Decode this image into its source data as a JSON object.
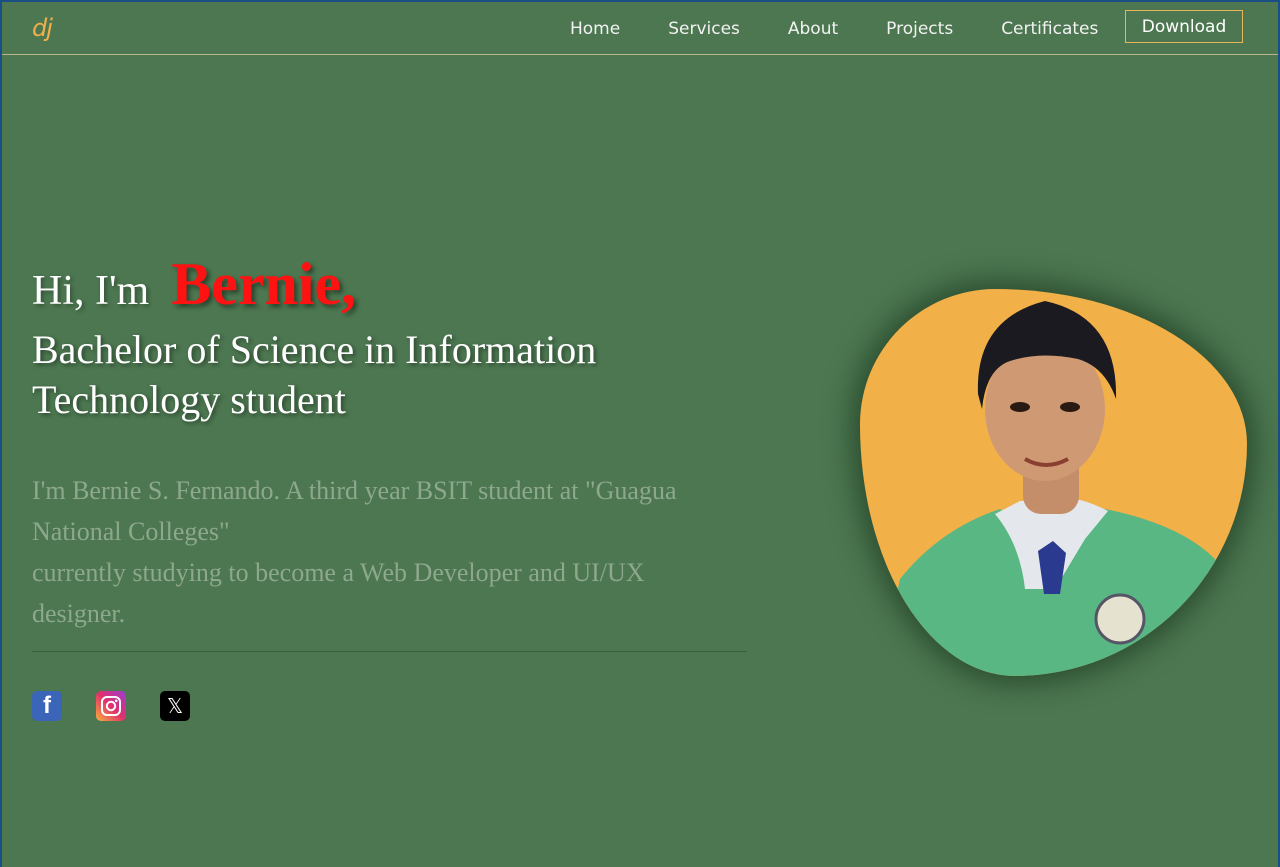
{
  "brand": {
    "logo": "dj"
  },
  "nav": {
    "items": [
      "Home",
      "Services",
      "About",
      "Projects",
      "Certificates"
    ],
    "download_label": "Download"
  },
  "hero": {
    "greeting": "Hi, I'm",
    "name": "Bernie,",
    "role": "Bachelor of Science in Information Technology student",
    "description_line1": "I'm Bernie S. Fernando. A third year BSIT student at \"Guagua National Colleges\"",
    "description_line2": "currently studying to become a Web Developer and UI/UX designer."
  },
  "socials": [
    {
      "icon": "facebook-icon"
    },
    {
      "icon": "instagram-icon"
    },
    {
      "icon": "x-twitter-icon"
    }
  ],
  "colors": {
    "background": "#4c7750",
    "name_accent": "#ff1212",
    "photo_bg": "#f2b048",
    "button_border": "#e8b65a"
  }
}
